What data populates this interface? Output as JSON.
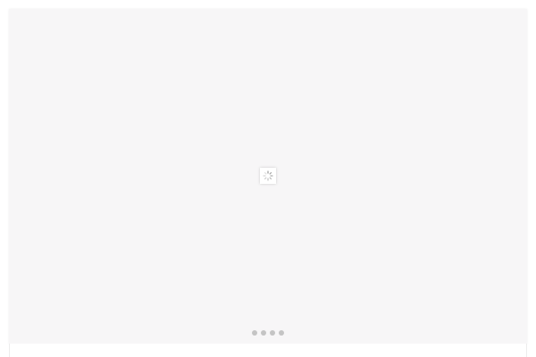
{
  "carousel": {
    "loading": true,
    "slide_count": 4,
    "active_index": 0,
    "colors": {
      "panel_bg": "#f7f6f7",
      "dot": "#c4c4c4",
      "spinner": "#9a9a9a"
    },
    "icons": {
      "loader": "spinner-icon"
    }
  }
}
